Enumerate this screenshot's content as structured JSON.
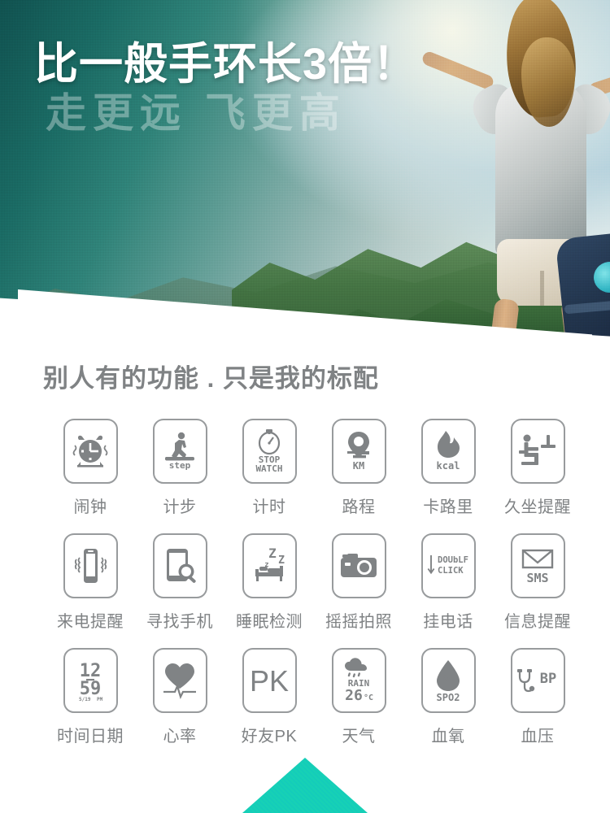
{
  "hero": {
    "headline": "比一般手环长3倍！",
    "subline": "走更远 飞更高",
    "photo_alt": "woman-arms-outstretched-mountaintop"
  },
  "features": {
    "section_title": "别人有的功能 . 只是我的标配",
    "items": [
      {
        "label": "闹钟",
        "icon": "alarm-clock-icon",
        "glyph_text": ""
      },
      {
        "label": "计步",
        "icon": "pedometer-step-icon",
        "glyph_text": "step"
      },
      {
        "label": "计时",
        "icon": "stopwatch-icon",
        "glyph_text": "STOP WATCH"
      },
      {
        "label": "路程",
        "icon": "distance-pin-icon",
        "glyph_text": "KM"
      },
      {
        "label": "卡路里",
        "icon": "calorie-flame-icon",
        "glyph_text": "kcal"
      },
      {
        "label": "久坐提醒",
        "icon": "sedentary-sitting-icon",
        "glyph_text": ""
      },
      {
        "label": "来电提醒",
        "icon": "phone-vibrate-icon",
        "glyph_text": ""
      },
      {
        "label": "寻找手机",
        "icon": "find-phone-search-icon",
        "glyph_text": ""
      },
      {
        "label": "睡眠检测",
        "icon": "sleep-bed-zzz-icon",
        "glyph_text": "Zzz"
      },
      {
        "label": "摇摇拍照",
        "icon": "camera-shake-icon",
        "glyph_text": ""
      },
      {
        "label": "挂电话",
        "icon": "double-click-icon",
        "glyph_text": "DOUbLF CLICK"
      },
      {
        "label": "信息提醒",
        "icon": "sms-envelope-icon",
        "glyph_text": "SMS"
      },
      {
        "label": "时间日期",
        "icon": "clock-date-icon",
        "glyph_text": "12 59"
      },
      {
        "label": "心率",
        "icon": "heart-rate-icon",
        "glyph_text": ""
      },
      {
        "label": "好友PK",
        "icon": "friend-pk-icon",
        "glyph_text": "PK"
      },
      {
        "label": "天气",
        "icon": "weather-rain-icon",
        "glyph_text": "RAIN 26°C"
      },
      {
        "label": "血氧",
        "icon": "spo2-droplet-icon",
        "glyph_text": "SPO2"
      },
      {
        "label": "血压",
        "icon": "blood-pressure-icon",
        "glyph_text": "BP"
      }
    ],
    "icon_texts": {
      "step": "step",
      "stop": "STOP",
      "watch": "WATCH",
      "km": "KM",
      "kcal": "kcal",
      "double": "DOUbLF",
      "click": "CLICK",
      "sms": "SMS",
      "clock_hour": "12",
      "clock_minute": "59",
      "clock_sub_left": "5/19",
      "clock_sub_right": "PM",
      "pk": "PK",
      "rain": "RAIN",
      "temp": "26",
      "temp_unit": "°C",
      "o2": "O2",
      "spo2": "SPO2",
      "bp": "BP",
      "zzz_big": "Z",
      "zzz_mid": "z",
      "zzz_small": "z"
    }
  },
  "colors": {
    "label_gray": "#7f8284",
    "border_gray": "#989b9d",
    "icon_gray": "#808385",
    "teal_triangle": "#19c8ae",
    "hero_teal": "#10514f"
  }
}
